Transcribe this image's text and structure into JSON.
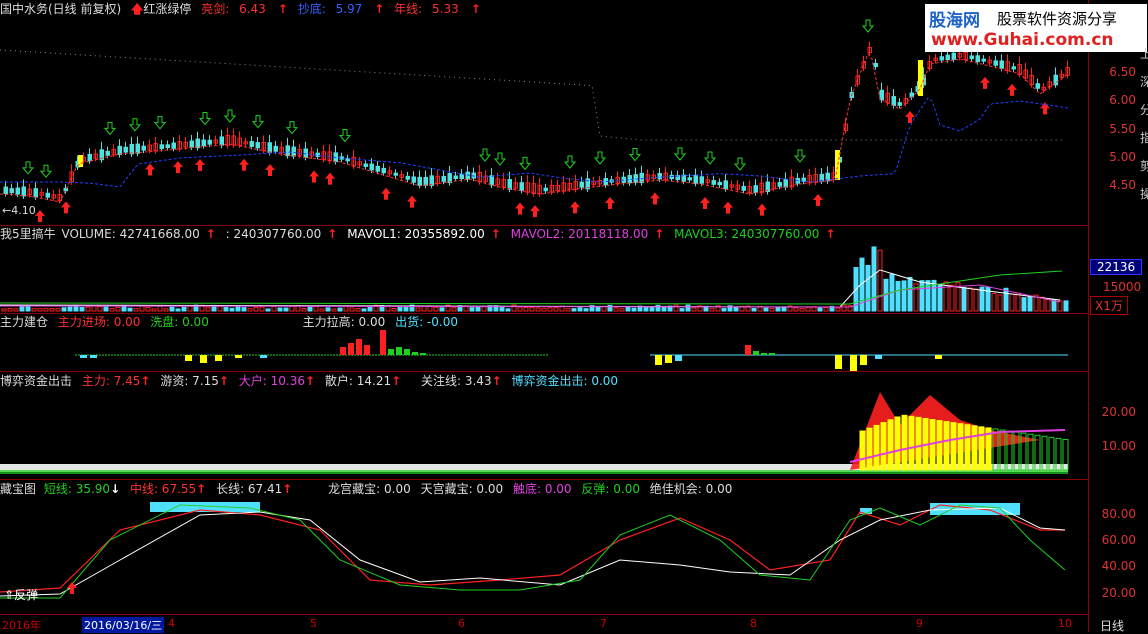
{
  "panel1": {
    "title": "国中水务(日线 前复权)",
    "signal": "红涨绿停",
    "liangjian_label": "亮剑:",
    "liangjian_value": "6.43",
    "chaodi_label": "抄底:",
    "chaodi_value": "5.97",
    "nianxian_label": "年线:",
    "nianxian_value": "5.33",
    "low_marker": "4.10",
    "axis": [
      "6.50",
      "6.00",
      "5.50",
      "5.00",
      "4.50"
    ]
  },
  "panel2": {
    "title": "我5里搞牛",
    "volume_label": "VOLUME: 42741668.00",
    "v2": ": 240307760.00",
    "mavol1": "MAVOL1: 20355892.00",
    "mavol2": "MAVOL2: 20118118.00",
    "mavol3": "MAVOL3: 240307760.00",
    "axis_hi": "22136",
    "axis_mid": "15000",
    "unit": "X1万"
  },
  "panel3": {
    "title": "主力建仓",
    "jinchang": "主力进场: 0.00",
    "xipan": "洗盘: 0.00",
    "lagao": "主力拉高: 0.00",
    "chuhuo": "出货: -0.00"
  },
  "panel4": {
    "title": "博弈资金出击",
    "zhuli": "主力: 7.45",
    "youzi": "游资: 7.15",
    "dahu": "大户: 10.36",
    "sanhu": "散户: 14.21",
    "guanzhu": "关注线: 3.43",
    "boyi": "博弈资金出击: 0.00",
    "axis": [
      "20.00",
      "10.00"
    ]
  },
  "panel5": {
    "title": "藏宝图",
    "duanxian": "短线: 35.90",
    "zhongxian": "中线: 67.55",
    "changxian": "长线: 67.41",
    "longgong": "龙宫藏宝: 0.00",
    "tiangong": "天宫藏宝: 0.00",
    "chudi": "触底: 0.00",
    "fantan": "反弹: 0.00",
    "jiajia": "绝佳机会: 0.00",
    "fantan_marker": "反弹",
    "axis": [
      "80.00",
      "60.00",
      "40.00",
      "20.00"
    ]
  },
  "xaxis": {
    "year": "2016年",
    "date": "2016/03/16/三",
    "months": [
      "4",
      "5",
      "6",
      "7",
      "8",
      "9",
      "10"
    ],
    "period": "日线"
  },
  "watermark": {
    "brand": "股海网",
    "slogan": "股票软件资源分享",
    "url": "www.Guhai.com.cn"
  },
  "right_edge": [
    "上",
    "深",
    "分",
    "指",
    "剪",
    "操"
  ],
  "colors": {
    "up": "#ff2020",
    "down": "#4fe0e0",
    "ma_red": "#ff3030",
    "ma_blue": "#2040ff",
    "yellow": "#ffff00",
    "green": "#20d020",
    "magenta": "#e040e0",
    "cyan": "#50e0ff",
    "white": "#ffffff"
  }
}
